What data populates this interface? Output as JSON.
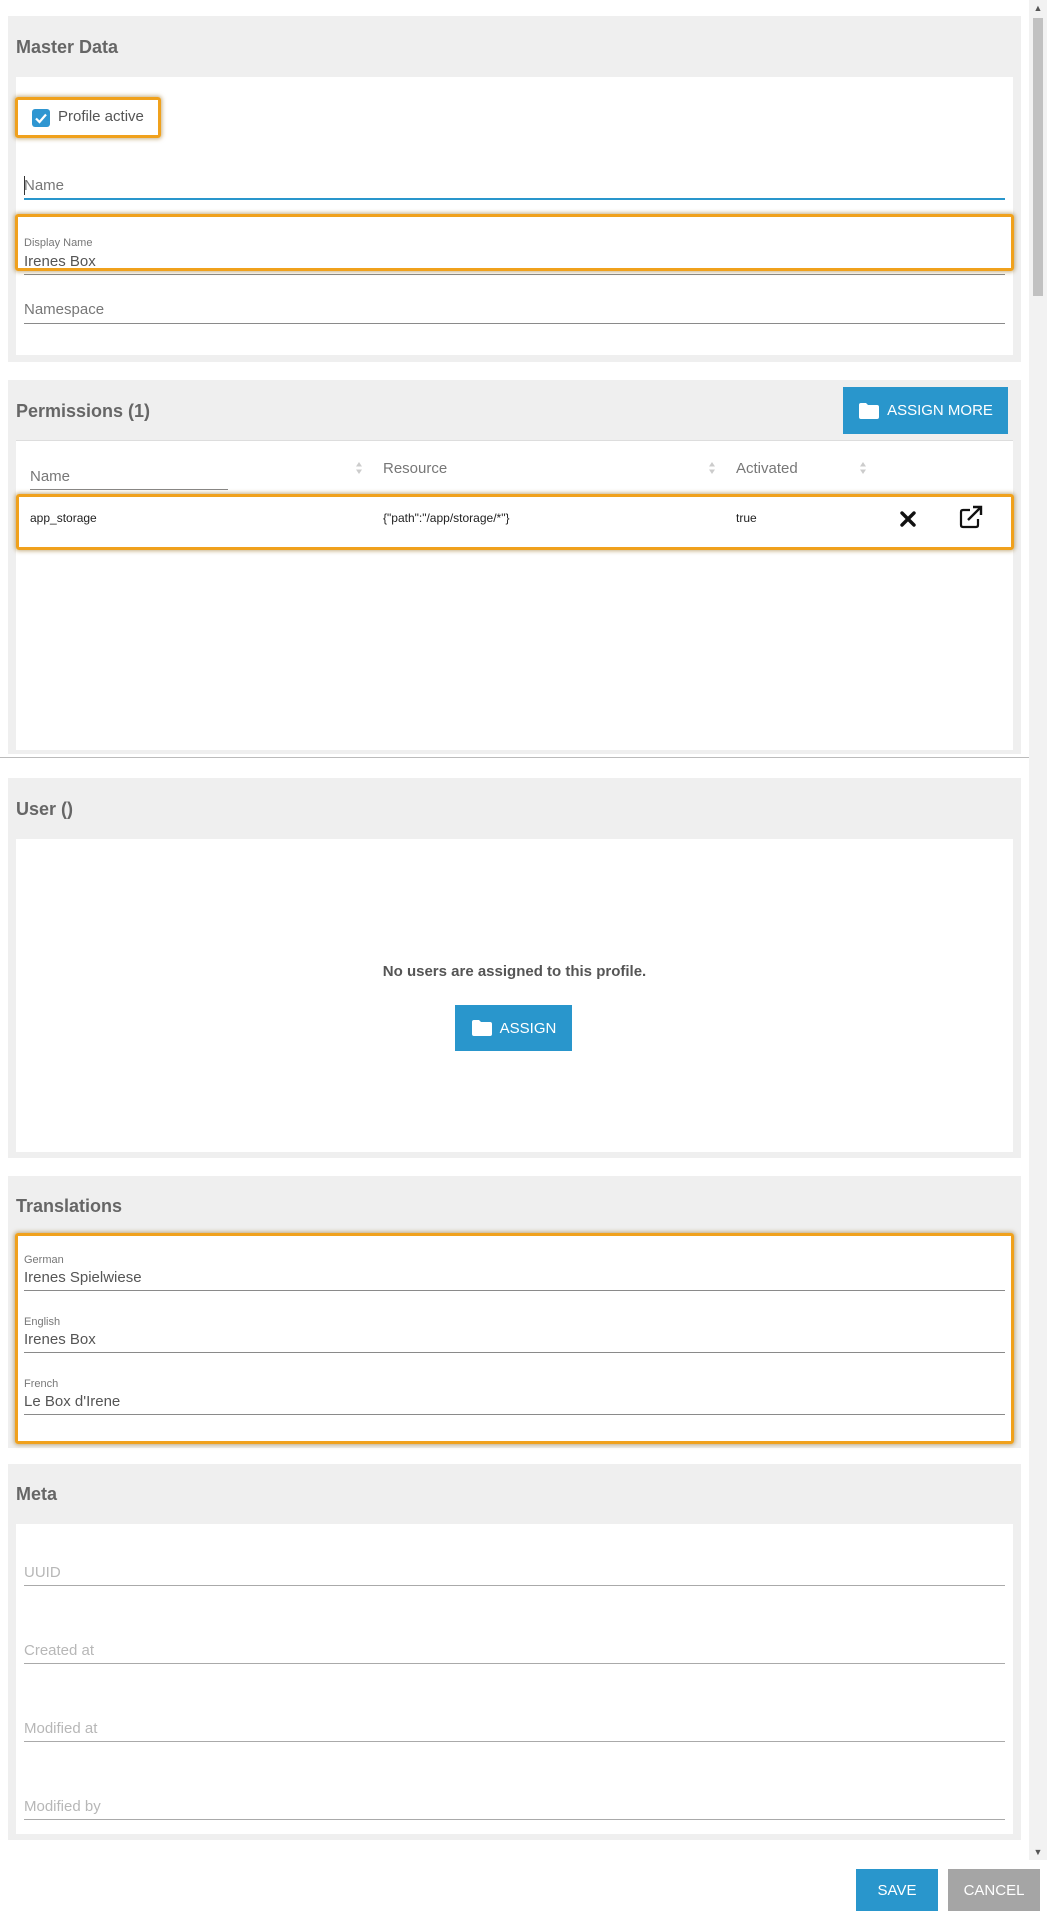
{
  "master": {
    "title": "Master Data",
    "profile_active_label": "Profile active",
    "name_placeholder": "Name",
    "display_name_label": "Display Name",
    "display_name_value": "Irenes Box",
    "namespace_placeholder": "Namespace"
  },
  "permissions": {
    "title": "Permissions (1)",
    "assign_more_label": "ASSIGN MORE",
    "filter_placeholder": "Name",
    "columns": [
      "Resource",
      "Activated"
    ],
    "rows": [
      {
        "name": "app_storage",
        "resource": "{\"path\":\"/app/storage/*\"}",
        "activated": "true"
      }
    ]
  },
  "users": {
    "title": "User ()",
    "empty_message": "No users are assigned to this profile.",
    "assign_label": "ASSIGN"
  },
  "translations": {
    "title": "Translations",
    "items": [
      {
        "label": "German",
        "value": "Irenes Spielwiese"
      },
      {
        "label": "English",
        "value": "Irenes Box"
      },
      {
        "label": "French",
        "value": "Le Box d'Irene"
      }
    ]
  },
  "meta": {
    "title": "Meta",
    "fields": [
      "UUID",
      "Created at",
      "Modified at",
      "Modified by"
    ]
  },
  "footer": {
    "save_label": "SAVE",
    "cancel_label": "CANCEL"
  },
  "colors": {
    "accent": "#2996cc",
    "highlight": "#f0a11c",
    "panel_bg": "#efefef",
    "cancel_bg": "#a5a5a5"
  }
}
